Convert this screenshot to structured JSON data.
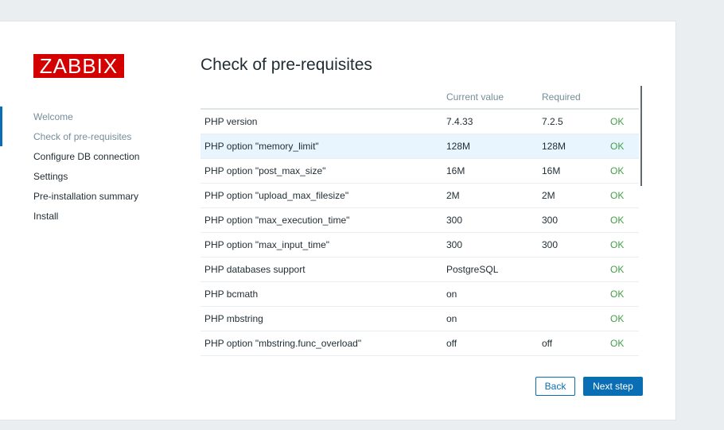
{
  "logo": "ZABBIX",
  "sidebar": {
    "steps": [
      {
        "label": "Welcome"
      },
      {
        "label": "Check of pre-requisites"
      },
      {
        "label": "Configure DB connection"
      },
      {
        "label": "Settings"
      },
      {
        "label": "Pre-installation summary"
      },
      {
        "label": "Install"
      }
    ]
  },
  "main": {
    "title": "Check of pre-requisites",
    "table": {
      "headers": [
        "",
        "Current value",
        "Required",
        ""
      ],
      "rows": [
        [
          "PHP version",
          "7.4.33",
          "7.2.5",
          "OK"
        ],
        [
          "PHP option \"memory_limit\"",
          "128M",
          "128M",
          "OK"
        ],
        [
          "PHP option \"post_max_size\"",
          "16M",
          "16M",
          "OK"
        ],
        [
          "PHP option \"upload_max_filesize\"",
          "2M",
          "2M",
          "OK"
        ],
        [
          "PHP option \"max_execution_time\"",
          "300",
          "300",
          "OK"
        ],
        [
          "PHP option \"max_input_time\"",
          "300",
          "300",
          "OK"
        ],
        [
          "PHP databases support",
          "PostgreSQL",
          "",
          "OK"
        ],
        [
          "PHP bcmath",
          "on",
          "",
          "OK"
        ],
        [
          "PHP mbstring",
          "on",
          "",
          "OK"
        ],
        [
          "PHP option \"mbstring.func_overload\"",
          "off",
          "off",
          "OK"
        ]
      ]
    }
  },
  "buttons": {
    "back": "Back",
    "next": "Next step"
  },
  "colors": {
    "brand": "#d40000",
    "accent": "#0a6eb4",
    "ok": "#429e47"
  }
}
